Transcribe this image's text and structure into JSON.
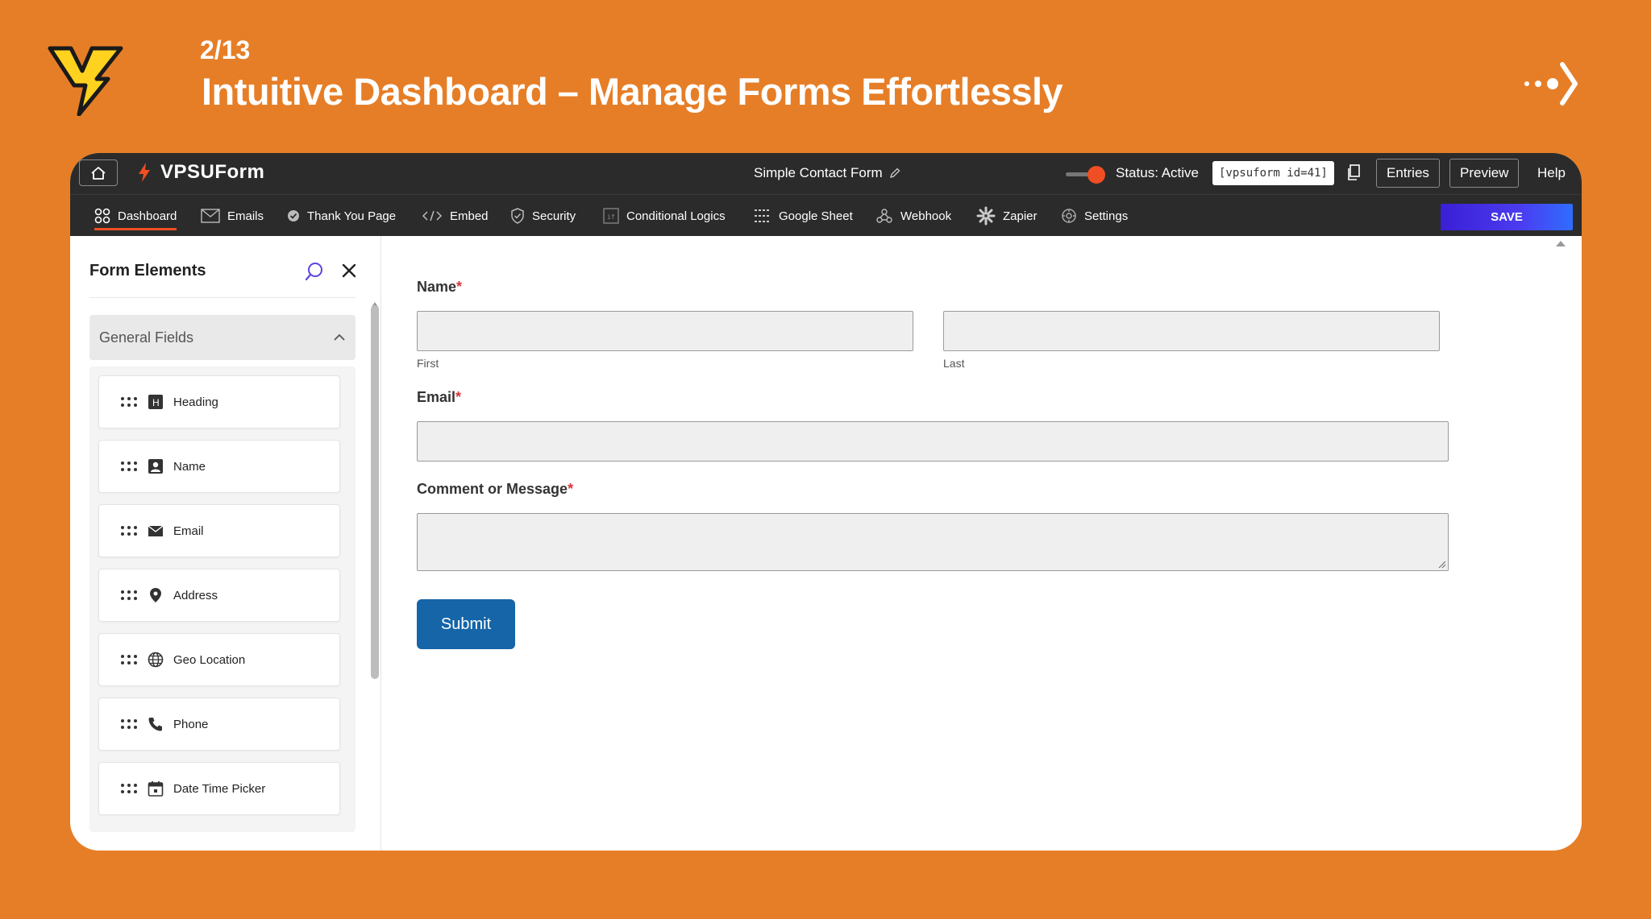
{
  "slide": {
    "counter": "2/13",
    "title": "Intuitive Dashboard – Manage Forms Effortlessly"
  },
  "topbar": {
    "brand": "VPSUForm",
    "form_name": "Simple Contact Form",
    "status": "Status: Active",
    "shortcode": "[vpsuform id=41]",
    "entries": "Entries",
    "preview": "Preview",
    "help": "Help"
  },
  "nav": {
    "items": [
      {
        "label": "Dashboard",
        "icon": "dashboard-icon"
      },
      {
        "label": "Emails",
        "icon": "envelope-icon"
      },
      {
        "label": "Thank You Page",
        "icon": "check-badge-icon"
      },
      {
        "label": "Embed",
        "icon": "code-icon"
      },
      {
        "label": "Security",
        "icon": "shield-icon"
      },
      {
        "label": "Conditional Logics",
        "icon": "logic-icon"
      },
      {
        "label": "Google Sheet",
        "icon": "sheet-icon"
      },
      {
        "label": "Webhook",
        "icon": "webhook-icon"
      },
      {
        "label": "Zapier",
        "icon": "zapier-icon"
      },
      {
        "label": "Settings",
        "icon": "gear-icon"
      }
    ],
    "save": "SAVE"
  },
  "sidebar": {
    "title": "Form Elements",
    "group": "General Fields",
    "fields": [
      {
        "label": "Heading",
        "icon": "heading-icon"
      },
      {
        "label": "Name",
        "icon": "person-icon"
      },
      {
        "label": "Email",
        "icon": "envelope-icon"
      },
      {
        "label": "Address",
        "icon": "map-pin-icon"
      },
      {
        "label": "Geo Location",
        "icon": "globe-icon"
      },
      {
        "label": "Phone",
        "icon": "phone-icon"
      },
      {
        "label": "Date Time Picker",
        "icon": "calendar-icon"
      }
    ]
  },
  "form": {
    "name_label": "Name",
    "first_label": "First",
    "last_label": "Last",
    "email_label": "Email",
    "message_label": "Comment or Message",
    "required_mark": "*",
    "submit": "Submit"
  },
  "colors": {
    "background": "#E67E27",
    "topbar": "#2b2b2b",
    "accent": "#F04E23",
    "submit": "#1565a8",
    "save_gradient_start": "#3a1fd6"
  }
}
